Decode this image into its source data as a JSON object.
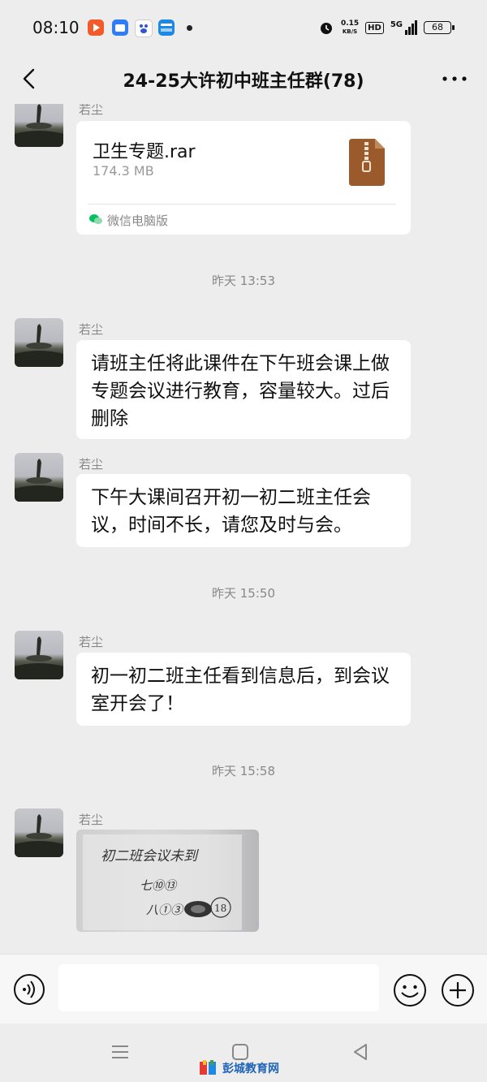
{
  "status_bar": {
    "time": "08:10",
    "net_speed_value": "0.15",
    "net_speed_unit": "KB/S",
    "hd": "HD",
    "signal": "5G",
    "battery": "68"
  },
  "header": {
    "title": "24-25大许初中班主任群(78)"
  },
  "messages": {
    "file": {
      "sender": "若尘",
      "file_name": "卫生专题.rar",
      "file_size": "174.3 MB",
      "source": "微信电脑版"
    },
    "ts1": "昨天 13:53",
    "m1": {
      "sender": "若尘",
      "text": "请班主任将此课件在下午班会课上做专题会议进行教育，容量较大。过后删除"
    },
    "m2": {
      "sender": "若尘",
      "text": "下午大课间召开初一初二班主任会议，时间不长，请您及时与会。"
    },
    "ts2": "昨天 15:50",
    "m3": {
      "sender": "若尘",
      "text": "初一初二班主任看到信息后，到会议室开会了！"
    },
    "ts3": "昨天 15:58",
    "m4": {
      "sender": "若尘",
      "photo_line1": "初二班会议未到",
      "photo_line2": "七⑩⑬",
      "photo_line3": "八①③",
      "photo_mark": "18"
    }
  },
  "input": {
    "placeholder": ""
  },
  "watermark": {
    "text": "彭城教育网"
  },
  "colors": {
    "bubble": "#ffffff",
    "background": "#ededed",
    "wechat_green": "#07c160"
  }
}
